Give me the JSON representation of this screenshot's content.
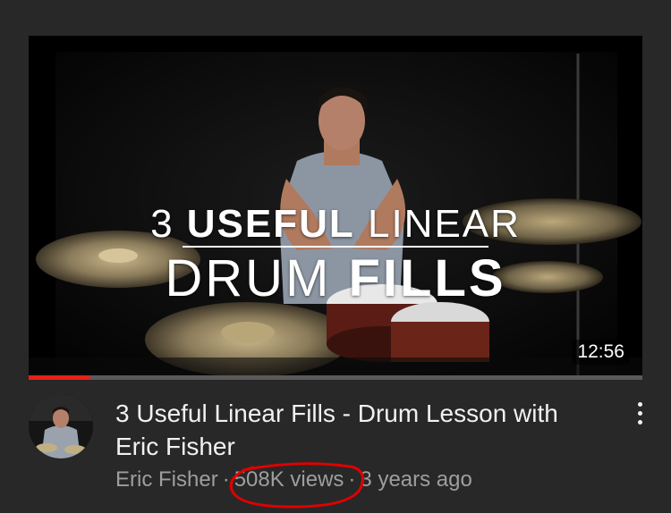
{
  "video": {
    "thumbnail_text": {
      "line1_light": "3 ",
      "line1_bold": "USEFUL",
      "line1_light2": " LINEAR",
      "line2_light": "DRUM ",
      "line2_bold": "FILLS"
    },
    "duration": "12:56",
    "watch_progress_fraction": 0.1,
    "title": "3 Useful Linear Fills - Drum Lesson with Eric Fisher",
    "channel": "Eric Fisher",
    "separator": "·",
    "views": "508K views",
    "age": "3 years ago",
    "more_icon": "more-vert-icon"
  },
  "colors": {
    "background": "#282828",
    "progress": "#e62117",
    "annotation": "#e00000",
    "meta_text": "#9e9e9e"
  }
}
